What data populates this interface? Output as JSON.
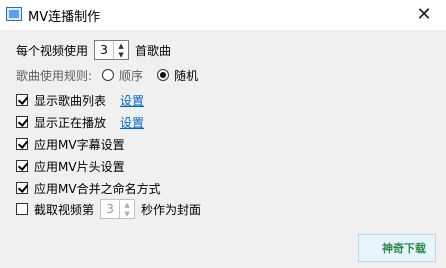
{
  "window": {
    "title": "MV连播制作",
    "close_glyph": "✕"
  },
  "song_count": {
    "label_prefix": "每个视频使用",
    "value": "3",
    "label_suffix": "首歌曲"
  },
  "song_rule": {
    "label": "歌曲使用规则:",
    "options": [
      "顺序",
      "随机"
    ],
    "selected": "随机"
  },
  "options": [
    {
      "label": "显示歌曲列表",
      "checked": true,
      "link": "设置"
    },
    {
      "label": "显示正在播放",
      "checked": true,
      "link": "设置"
    },
    {
      "label": "应用MV字幕设置",
      "checked": true
    },
    {
      "label": "应用MV片头设置",
      "checked": true
    },
    {
      "label": "应用MV合并之命名方式",
      "checked": true
    }
  ],
  "cover": {
    "label_prefix": "截取视频第",
    "value": "3",
    "label_suffix": "秒作为封面",
    "checked": false
  },
  "watermark": "神奇下载"
}
